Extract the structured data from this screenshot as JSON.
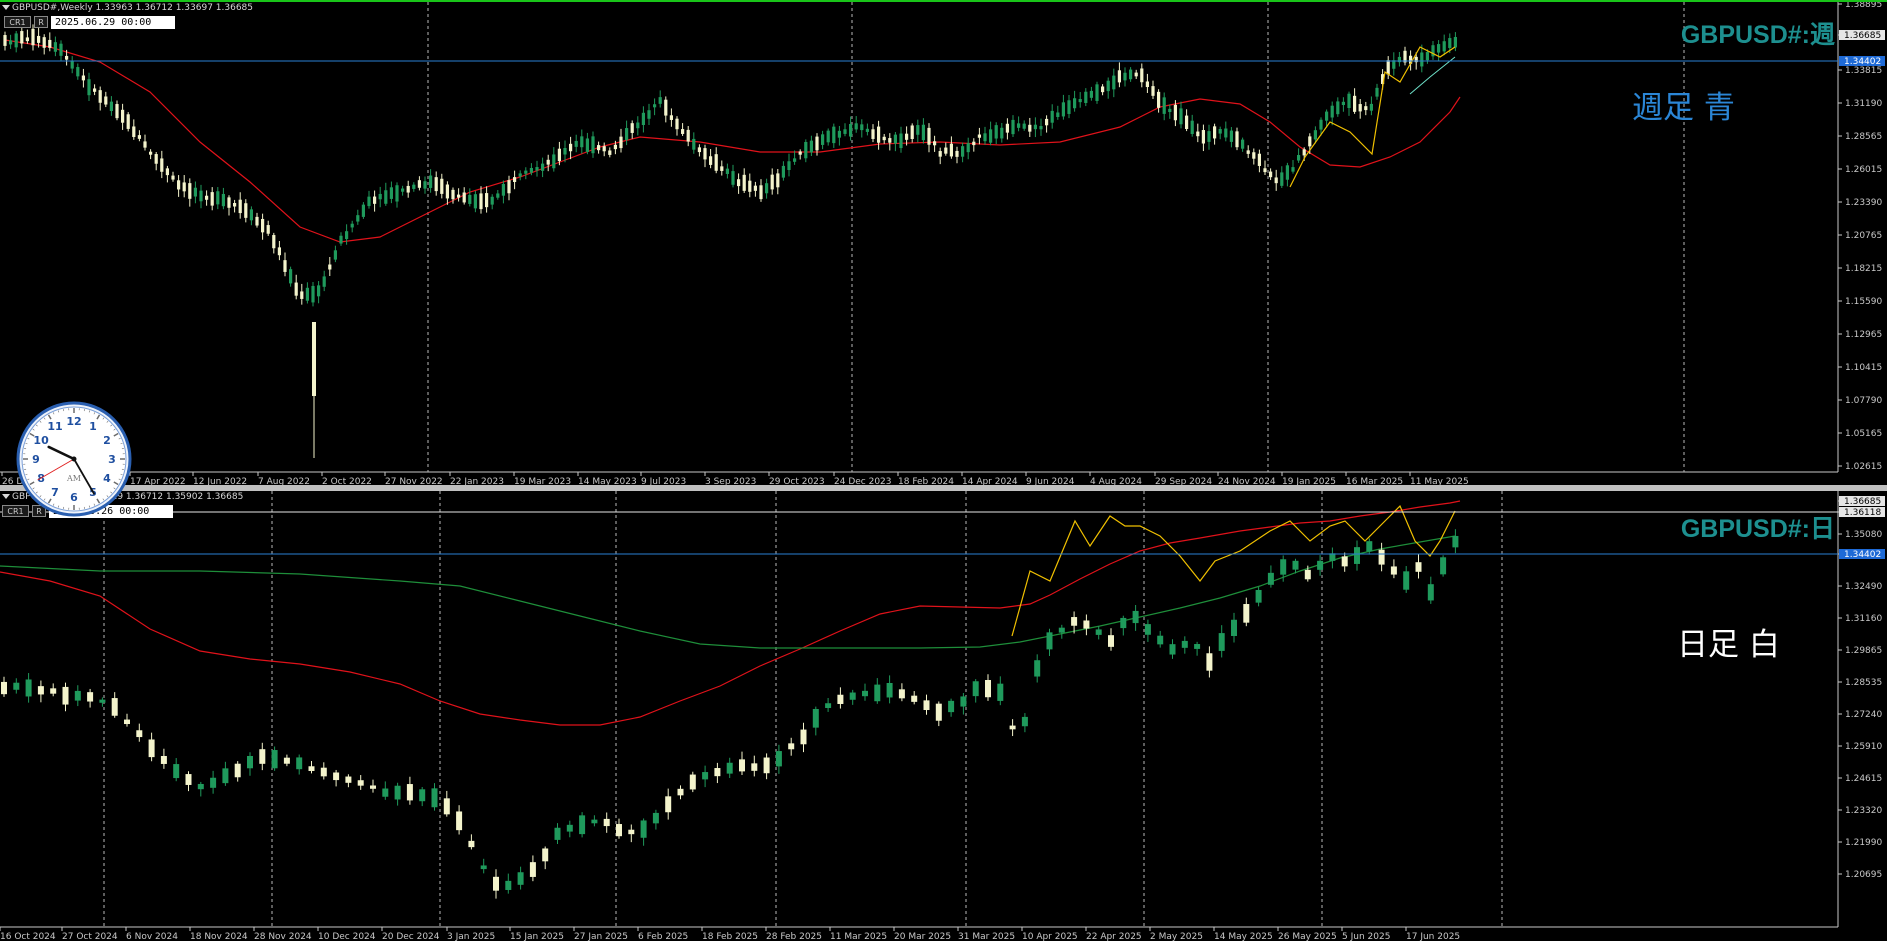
{
  "colors": {
    "background": "#000000",
    "bull_candle": "#1f9a5c",
    "bear_candle": "#f4f4cc",
    "ma_red": "#e0121a",
    "ma_green": "#1e8e3a",
    "hline_blue": "#2a7fd4",
    "hline_white": "#e6e6e6",
    "zigzag": "#f0c000",
    "symbol_text": "#1d8f8f",
    "note_blue": "#2b86d6",
    "note_white": "#ffffff",
    "price_tag_blue": "#1e6ad6"
  },
  "top_panel": {
    "title": "GBPUSD#,Weekly  1.33963 1.36712 1.33697 1.36685",
    "btn_cr": "CR1",
    "btn_r": "R",
    "datetime": "2025.06.29 00:00",
    "symbol_label": "GBPUSD#:週",
    "note": "週足  青",
    "blue_line_price": "1.34402",
    "current_price": "1.36685",
    "price_labels": [
      "1.38895",
      "1.36685",
      "1.33815",
      "1.31190",
      "1.28565",
      "1.26015",
      "1.23390",
      "1.20765",
      "1.18215",
      "1.15590",
      "1.12965",
      "1.10415",
      "1.07790",
      "1.05165",
      "1.02615"
    ],
    "date_labels": [
      "26 Dec 2021",
      "17 Apr 2022",
      "12 Jun 2022",
      "7 Aug 2022",
      "2 Oct 2022",
      "27 Nov 2022",
      "22 Jan 2023",
      "19 Mar 2023",
      "14 May 2023",
      "9 Jul 2023",
      "3 Sep 2023",
      "29 Oct 2023",
      "24 Dec 2023",
      "18 Feb 2024",
      "14 Apr 2024",
      "9 Jun 2024",
      "4 Aug 2024",
      "29 Sep 2024",
      "24 Nov 2024",
      "19 Jan 2025",
      "16 Mar 2025",
      "11 May 2025"
    ]
  },
  "bottom_panel": {
    "title": "GBPUSD#,Daily  1.36529 1.36712 1.35902 1.36685",
    "btn_cr": "CR1",
    "btn_r": "R",
    "datetime": "2025.06.26 00:00",
    "symbol_label": "GBPUSD#:日",
    "note": "日足  白",
    "blue_line_price": "1.34402",
    "white_line_price": "1.36118",
    "current_price": "1.36685",
    "price_labels": [
      "1.36685",
      "1.36118",
      "1.35080",
      "1.33786",
      "1.32490",
      "1.31160",
      "1.29865",
      "1.28535",
      "1.27240",
      "1.25910",
      "1.24615",
      "1.23320",
      "1.21990",
      "1.20695"
    ],
    "date_labels": [
      "16 Oct 2024",
      "27 Oct 2024",
      "6 Nov 2024",
      "18 Nov 2024",
      "28 Nov 2024",
      "10 Dec 2024",
      "20 Dec 2024",
      "3 Jan 2025",
      "15 Jan 2025",
      "27 Jan 2025",
      "6 Feb 2025",
      "18 Feb 2025",
      "28 Feb 2025",
      "11 Mar 2025",
      "20 Mar 2025",
      "31 Mar 2025",
      "10 Apr 2025",
      "22 Apr 2025",
      "2 May 2025",
      "14 May 2025",
      "26 May 2025",
      "5 Jun 2025",
      "17 Jun 2025"
    ]
  },
  "clock": {
    "numbers": [
      "12",
      "1",
      "2",
      "3",
      "4",
      "5",
      "6",
      "7",
      "8",
      "9",
      "10",
      "11"
    ],
    "ampm": "AM",
    "hour": 9.85,
    "minute": 25,
    "second": 40
  }
}
